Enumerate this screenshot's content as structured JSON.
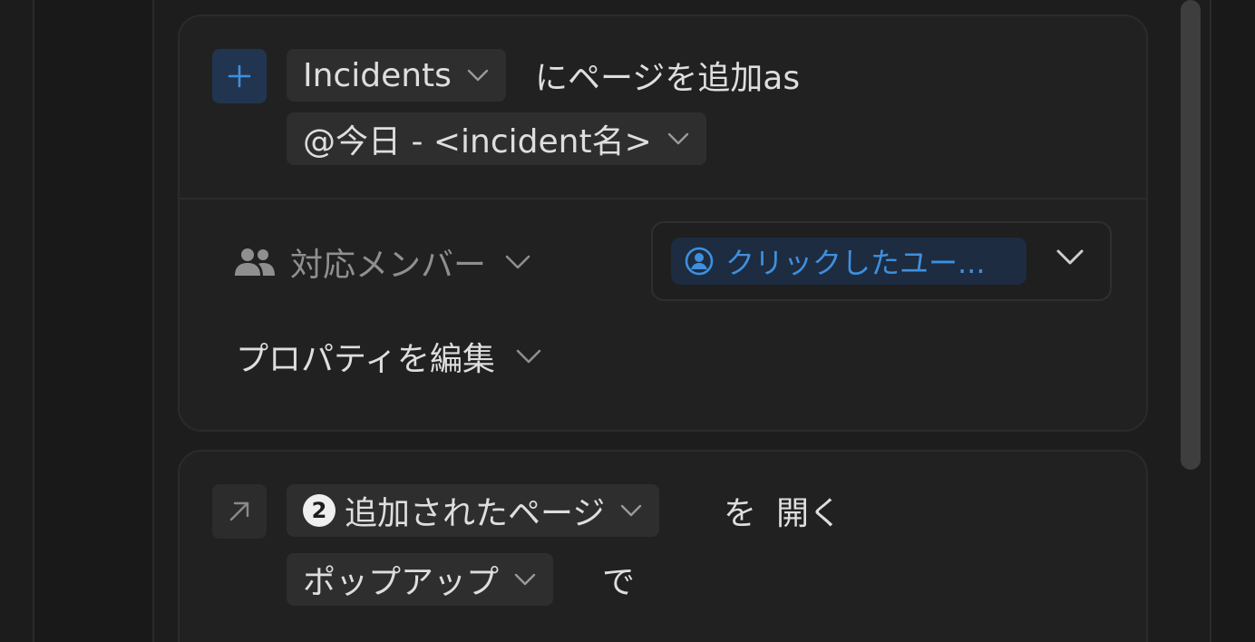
{
  "action_add_page": {
    "database_label": "Incidents",
    "connector_text": "にページを追加as",
    "title_template": "@今日 - <incident名>"
  },
  "properties": {
    "member_label": "対応メンバー",
    "member_value": "クリックしたユー...",
    "edit_label": "プロパティを編集"
  },
  "action_open_page": {
    "step_number": "2",
    "target_label": "追加されたページ",
    "wo_text": "を",
    "open_text": "開く",
    "mode_label": "ポップアップ",
    "de_text": "で"
  },
  "colors": {
    "background": "#191919",
    "card": "#212121",
    "accent_blue": "#3f8fde",
    "pill": "#2e2e2e"
  },
  "icons": [
    "plus-icon",
    "chevron-down-icon",
    "people-icon",
    "user-circle-icon",
    "arrow-up-right-icon"
  ]
}
